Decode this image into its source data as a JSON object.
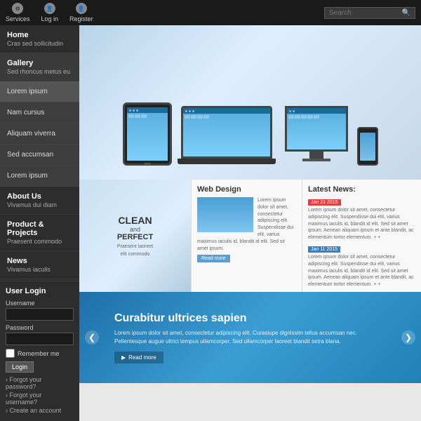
{
  "topbar": {
    "items": [
      {
        "label": "Services",
        "icon": "⚙"
      },
      {
        "label": "Log in",
        "icon": "👤"
      },
      {
        "label": "Register",
        "icon": "👤"
      }
    ],
    "search_placeholder": "Search"
  },
  "sidebar": {
    "nav_items": [
      {
        "title": "Home",
        "sub": "Cras sed sollicitudin",
        "active": false
      },
      {
        "title": "Gallery",
        "sub": "Sed rhoncus metus eu",
        "active": true
      },
      {
        "title": "About Us",
        "sub": "Vivamus dui diam",
        "active": false
      },
      {
        "title": "Product & Projects",
        "sub": "Praesent commodo",
        "active": false
      },
      {
        "title": "News",
        "sub": "Vivamus iaculis",
        "active": false
      }
    ],
    "dropdown_items": [
      {
        "label": "Lorem ipsum",
        "active": true
      },
      {
        "label": "Nam cursus",
        "active": false
      },
      {
        "label": "Aliquam viverra",
        "active": false
      },
      {
        "label": "Sed accumsan",
        "active": false
      },
      {
        "label": "Lorem ipsum",
        "active": false
      }
    ],
    "user_login": {
      "title": "User Login",
      "username_label": "Username",
      "password_label": "Password",
      "remember_label": "Remember me",
      "login_btn": "Login",
      "forgot_password": "Forgot your password?",
      "forgot_username": "Forgot your username?",
      "create_account": "Create an account"
    }
  },
  "devices_section": {
    "visible": true
  },
  "clean_section": {
    "line1": "CLEAN",
    "line2": "and",
    "line3": "PERFECT",
    "sub1": "Praesent laoreet",
    "sub2": "elit commodo"
  },
  "web_design": {
    "title": "Web Design",
    "body": "Lorem ipsum dolor sit amet, consectetur adipiscing elit. Suspendisse dui elit, varius maximus iaculis id, blandit id elit. Sed sit amet ipsum.",
    "read_more": "Read more"
  },
  "latest_news": {
    "title": "Latest News:",
    "items": [
      {
        "date": "Jan 21 2015",
        "text": "Lorem ipsum dolor sit amet, consectetur adipiscing elit. Suspendisse dui elit, varius maximus iaculis id, blandit id elit. Sed sit amet ipsum. Aenean aliquam ipsum et ante blandit, ac elementum tortor elementum. + +"
      },
      {
        "date": "Jan 11 2015",
        "text": "Lorem ipsum dolor sit amet, consectetur adipiscing elit. Suspendisse dui elit, varius maximus iaculis id, blandit id elit. Sed sit amet ipsum. Aenean aliquam ipsum et ante blandit, ac elementum tortor elementum. + +"
      }
    ]
  },
  "bottom_banner": {
    "title": "Curabitur ultrices sapien",
    "text": "Lorem ipsum dolor sit amet, consectetur adipiscing elit. Curasiupe dignissim tellus accumsan nec. Pellentesque augue ultrici tempus ullamcorper. Sed ullamcorper laoreet blandit setra blana.",
    "read_more": "Read more",
    "prev_icon": "❮",
    "next_icon": "❯"
  }
}
